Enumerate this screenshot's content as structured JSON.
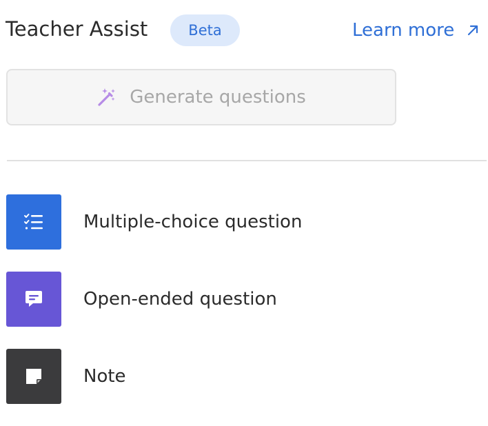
{
  "header": {
    "title": "Teacher Assist",
    "badge": "Beta",
    "learn_more": "Learn more",
    "learn_more_icon": "external-arrow-icon"
  },
  "generate": {
    "label": "Generate questions",
    "icon": "magic-wand-icon",
    "disabled": true
  },
  "items": [
    {
      "label": "Multiple-choice question",
      "icon": "checklist-icon",
      "color": "#2e6fdd"
    },
    {
      "label": "Open-ended question",
      "icon": "chat-bubble-icon",
      "color": "#6756d6"
    },
    {
      "label": "Note",
      "icon": "sticky-note-icon",
      "color": "#3b3b3d"
    }
  ],
  "colors": {
    "accent": "#2f6fd6",
    "badge_bg": "#dde9fb",
    "wand": "#b68ce6"
  }
}
